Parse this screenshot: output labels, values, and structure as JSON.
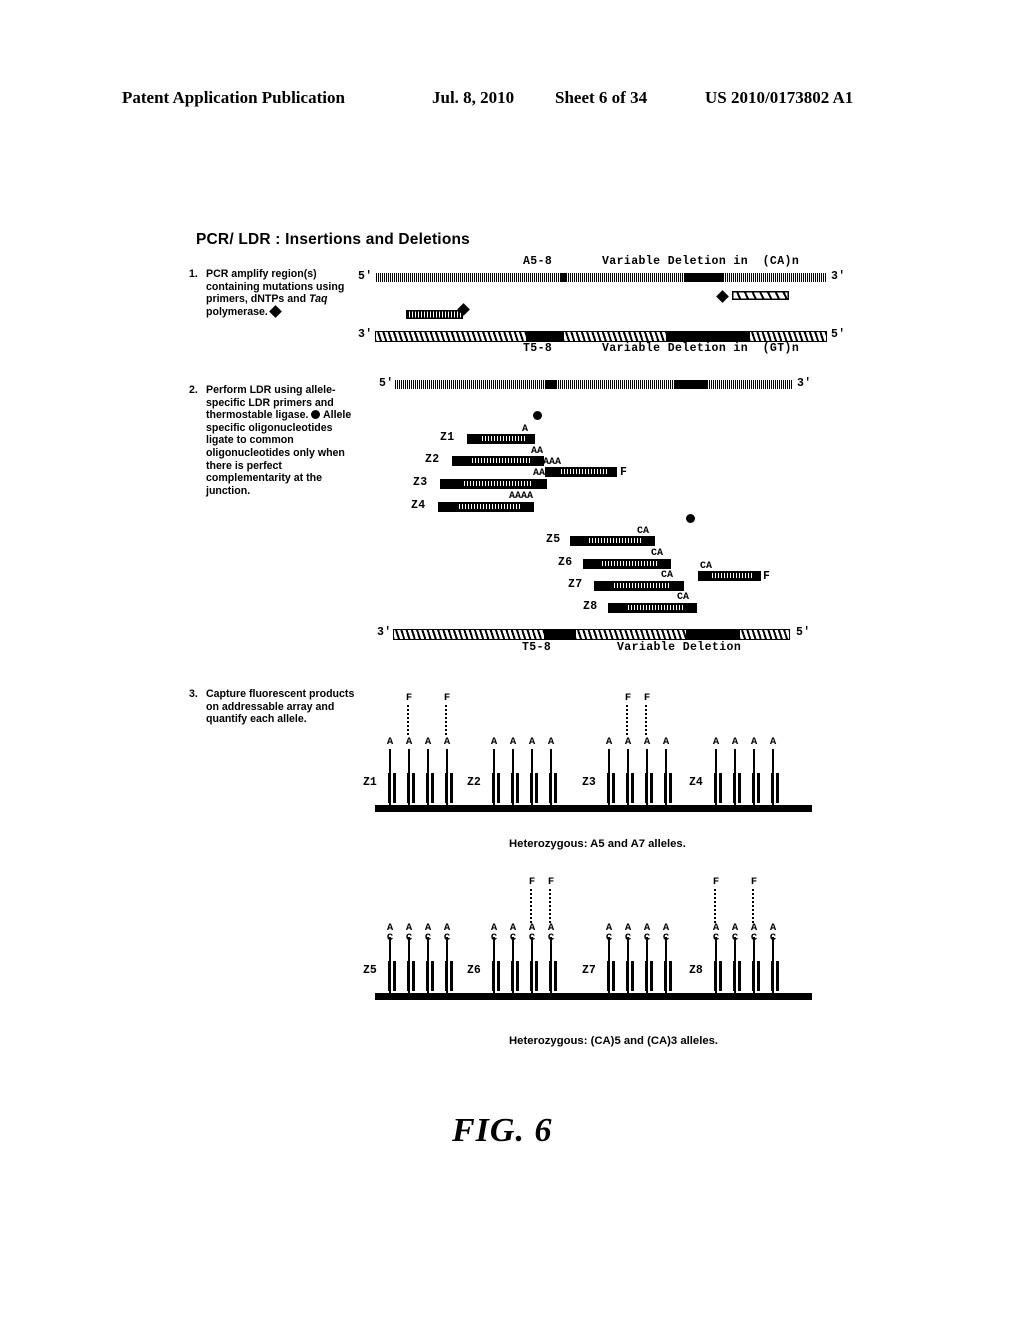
{
  "header": {
    "publication": "Patent Application Publication",
    "date": "Jul. 8, 2010",
    "sheet": "Sheet 6 of 34",
    "number": "US 2010/0173802 A1"
  },
  "figure": {
    "title": "PCR/ LDR : Insertions and Deletions",
    "caption": "FIG.  6"
  },
  "steps": [
    {
      "number": "1.",
      "text": "PCR amplify region(s) containing mutations using primers, dNTPs and Taq  polymerase."
    },
    {
      "number": "2.",
      "text": "Perform LDR using allele-specific LDR primers and thermostable ligase. Allele specific oligonucleotides ligate to common oligonucleotides only when there is perfect complementarity at the junction."
    },
    {
      "number": "3.",
      "text": "Capture fluorescent products on addressable array and quantify each allele."
    }
  ],
  "step1": {
    "top_strand": {
      "five_prime": "5'",
      "three_prime": "3'"
    },
    "bottom_strand": {
      "three_prime": "3'",
      "five_prime": "5'"
    },
    "top_labels": {
      "allele": "A5-8",
      "deletion": "Variable Deletion in  (CA)n"
    },
    "bottom_labels": {
      "allele": "T5-8",
      "deletion": "Variable Deletion in  (GT)n"
    }
  },
  "step2": {
    "template_top": {
      "five_prime": "5'",
      "three_prime": "3'"
    },
    "template_bottom": {
      "three_prime": "3'",
      "five_prime": "5'"
    },
    "bottom_labels": {
      "allele": "T5-8",
      "deletion": "Variable Deletion"
    },
    "group_a": {
      "probes": [
        {
          "zip": "Z1",
          "base": "A"
        },
        {
          "zip": "Z2",
          "base": "AA"
        },
        {
          "zip": "Z3",
          "base": "AAA"
        },
        {
          "zip": "Z4",
          "base": "AAAA"
        }
      ],
      "common": {
        "base": "AAAA",
        "fluor": "F"
      }
    },
    "group_b": {
      "probes": [
        {
          "zip": "Z5",
          "base": "CA"
        },
        {
          "zip": "Z6",
          "base": "CA"
        },
        {
          "zip": "Z7",
          "base": "CA"
        },
        {
          "zip": "Z8",
          "base": "CA"
        }
      ],
      "common": {
        "base": "CA",
        "fluor": "F"
      }
    }
  },
  "step3": {
    "array_one": {
      "caption": "Heterozygous: A5 and A7 alleles.",
      "groups": [
        {
          "zip": "Z1",
          "labels": [
            "A",
            "A",
            "A",
            "A"
          ],
          "fluor": [
            false,
            true,
            false,
            true
          ]
        },
        {
          "zip": "Z2",
          "labels": [
            "A",
            "A",
            "A",
            "A"
          ],
          "fluor": [
            false,
            false,
            false,
            false
          ]
        },
        {
          "zip": "Z3",
          "labels": [
            "A",
            "A",
            "A",
            "A"
          ],
          "fluor": [
            false,
            true,
            true,
            false
          ]
        },
        {
          "zip": "Z4",
          "labels": [
            "A",
            "A",
            "A",
            "A"
          ],
          "fluor": [
            false,
            false,
            false,
            false
          ]
        }
      ],
      "fluor_label": "F"
    },
    "array_two": {
      "caption": "Heterozygous: (CA)5  and (CA)3 alleles.",
      "groups": [
        {
          "zip": "Z5",
          "labels": [
            "A",
            "A",
            "A",
            "A"
          ],
          "labels2": [
            "C",
            "C",
            "C",
            "C"
          ],
          "fluor": [
            false,
            false,
            false,
            false
          ]
        },
        {
          "zip": "Z6",
          "labels": [
            "A",
            "A",
            "A",
            "A"
          ],
          "labels2": [
            "C",
            "C",
            "C",
            "C"
          ],
          "fluor": [
            false,
            false,
            true,
            true
          ]
        },
        {
          "zip": "Z7",
          "labels": [
            "A",
            "A",
            "A",
            "A"
          ],
          "labels2": [
            "C",
            "C",
            "C",
            "C"
          ],
          "fluor": [
            false,
            false,
            false,
            false
          ]
        },
        {
          "zip": "Z8",
          "labels": [
            "A",
            "A",
            "A",
            "A"
          ],
          "labels2": [
            "C",
            "C",
            "C",
            "C"
          ],
          "fluor": [
            true,
            false,
            true,
            false
          ]
        }
      ],
      "fluor_label": "F"
    }
  }
}
